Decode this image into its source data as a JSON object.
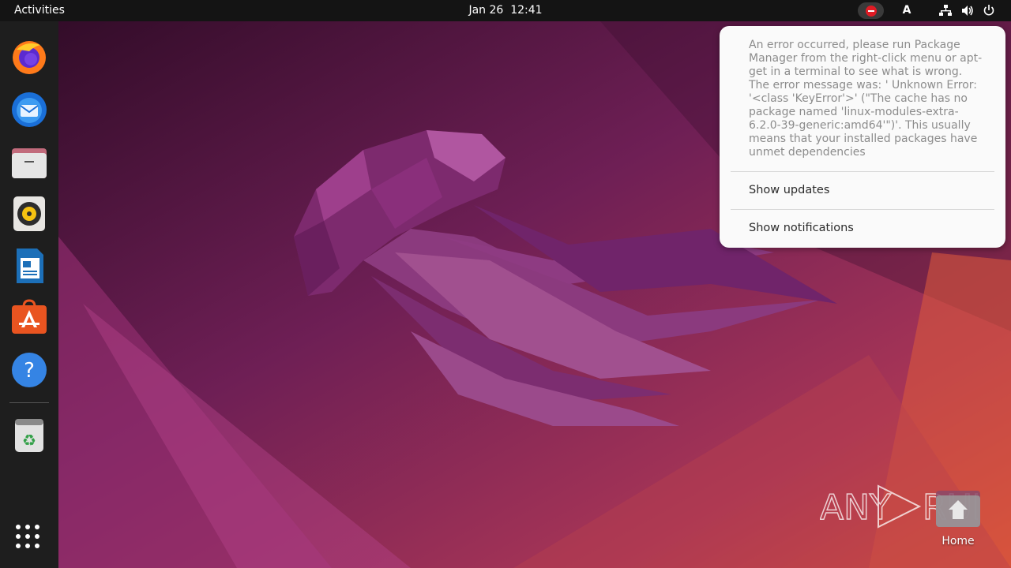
{
  "topbar": {
    "activities": "Activities",
    "date": "Jan 26",
    "time": "12:41",
    "keyboard_layout": "A",
    "indicators": [
      "error-icon",
      "network-icon",
      "volume-icon",
      "power-icon"
    ]
  },
  "dock": {
    "apps": [
      "Firefox",
      "Thunderbird Mail",
      "Files",
      "Rhythmbox",
      "LibreOffice Writer",
      "Ubuntu Software",
      "Help",
      "Trash"
    ],
    "show_apps": "Show Applications"
  },
  "notification_popup": {
    "message": "An error occurred, please run Package Manager from the right-click menu or apt-get in a terminal to see what is wrong.\nThe error message was: ' Unknown Error: '<class 'KeyError'>' (\"The cache has no package named 'linux-modules-extra-6.2.0-39-generic:amd64'\")'. This usually means that your installed packages have unmet dependencies",
    "items": [
      "Show updates",
      "Show notifications"
    ]
  },
  "desktop": {
    "home_label": "Home"
  },
  "watermark": "ANY RUN",
  "colors": {
    "topbar": "#141414",
    "dock": "#1e1e1e",
    "error_red": "#e01b24",
    "wallpaper_dark": "#3a0d2e",
    "wallpaper_orange": "#d5503a"
  }
}
